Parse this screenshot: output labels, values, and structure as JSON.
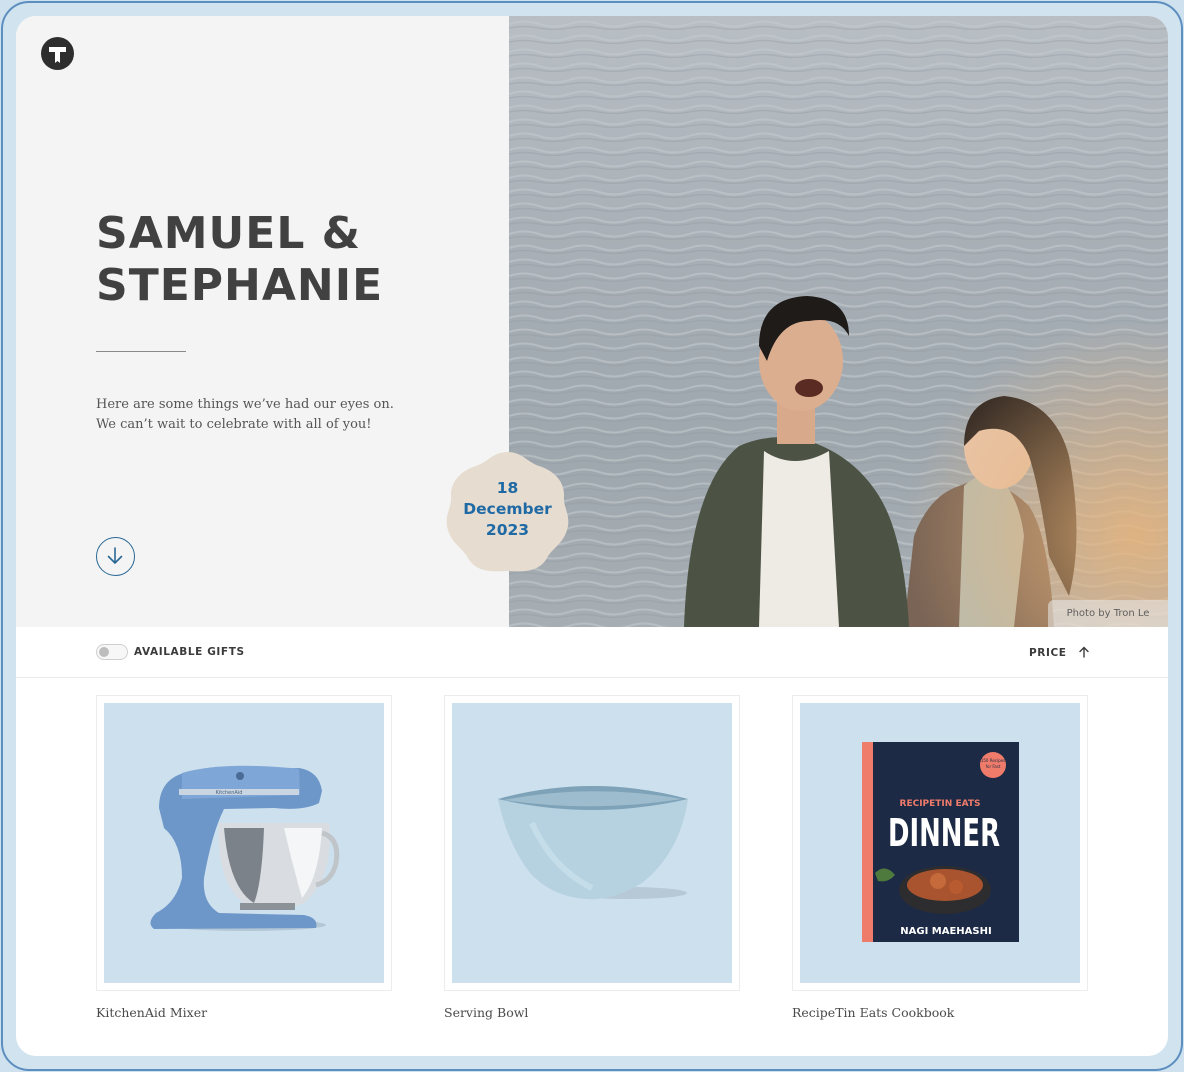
{
  "hero": {
    "name_line1": "SAMUEL &",
    "name_line2": "STEPHANIE",
    "intro_line1": "Here are some things we’ve had our eyes on.",
    "intro_line2": "We can’t wait to celebrate with all of you!",
    "date_day": "18",
    "date_month": "December",
    "date_year": "2023",
    "photo_credit": "Photo by Tron Le"
  },
  "filters": {
    "toggle_label": "AVAILABLE GIFTS",
    "toggle_on": false,
    "sort_label": "PRICE"
  },
  "products": [
    {
      "name": "KitchenAid Mixer"
    },
    {
      "name": "Serving Bowl"
    },
    {
      "name": "RecipeTin Eats Cookbook"
    }
  ],
  "book_cover": {
    "series": "RECIPETIN EATS",
    "title": "DINNER",
    "author": "NAGI MAEHASHI",
    "badge": "150 Recipes for Fast Everyday Meals"
  },
  "mixer_brand": "KitchenAid",
  "colors": {
    "accent": "#1f6aa5",
    "badge_bg": "#e6dccf",
    "product_bg": "#cde0ee",
    "hero_left_bg": "#f4f4f4"
  },
  "icons": [
    "logo-icon",
    "arrow-down-icon",
    "arrow-up-icon"
  ]
}
